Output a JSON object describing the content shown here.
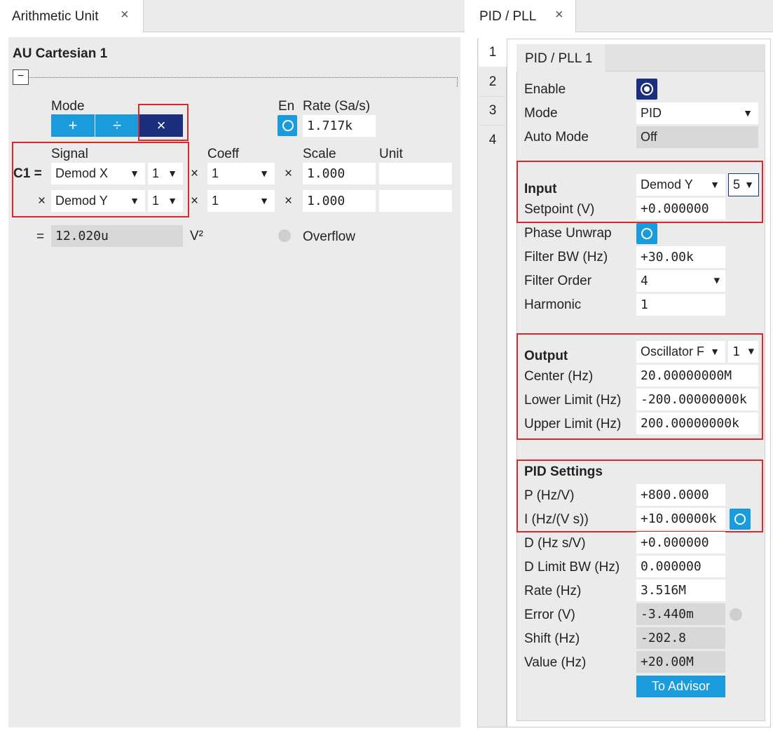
{
  "left": {
    "tab_title": "Arithmetic Unit",
    "tab_close": "×",
    "section_title": "AU Cartesian 1",
    "collapse_symbol": "−",
    "mode_label": "Mode",
    "mode_buttons": [
      "+",
      "÷",
      "×"
    ],
    "mode_selected": "×",
    "en_label": "En",
    "rate_label": "Rate (Sa/s)",
    "rate_value": "1.717k",
    "headers": {
      "signal": "Signal",
      "coeff": "Coeff",
      "scale": "Scale",
      "unit": "Unit"
    },
    "row_label": "C1 =",
    "rows": [
      {
        "prefix": "",
        "signal": "Demod X",
        "index": "1",
        "op1": "×",
        "coeff": "1",
        "op2": "×",
        "scale": "1.000",
        "unit": ""
      },
      {
        "prefix": "×",
        "signal": "Demod Y",
        "index": "1",
        "op1": "×",
        "coeff": "1",
        "op2": "×",
        "scale": "1.000",
        "unit": ""
      }
    ],
    "result_eq": "=",
    "result_value": "12.020u",
    "result_unit": "V²",
    "overflow_label": "Overflow"
  },
  "right": {
    "tab_title": "PID / PLL",
    "tab_close": "×",
    "side_tabs": [
      "1",
      "2",
      "3",
      "4"
    ],
    "inner_tab": "PID / PLL 1",
    "enable_label": "Enable",
    "mode_label": "Mode",
    "mode_value": "PID",
    "auto_mode_label": "Auto Mode",
    "auto_mode_value": "Off",
    "input_label": "Input",
    "input_signal": "Demod Y",
    "input_index": "5",
    "setpoint_label": "Setpoint (V)",
    "setpoint_value": "+0.000000",
    "phase_unwrap_label": "Phase Unwrap",
    "filter_bw_label": "Filter BW (Hz)",
    "filter_bw_value": "+30.00k",
    "filter_order_label": "Filter Order",
    "filter_order_value": "4",
    "harmonic_label": "Harmonic",
    "harmonic_value": "1",
    "output_label": "Output",
    "output_signal": "Oscillator F",
    "output_index": "1",
    "center_label": "Center (Hz)",
    "center_value": "20.00000000M",
    "lower_label": "Lower Limit (Hz)",
    "lower_value": "-200.00000000k",
    "upper_label": "Upper Limit (Hz)",
    "upper_value": "200.00000000k",
    "pid_settings_label": "PID Settings",
    "p_label": "P (Hz/V)",
    "p_value": "+800.0000",
    "i_label": "I (Hz/(V s))",
    "i_value": "+10.00000k",
    "d_label": "D (Hz s/V)",
    "d_value": "+0.000000",
    "dlimit_label": "D Limit BW (Hz)",
    "dlimit_value": "0.000000",
    "rate_label": "Rate (Hz)",
    "rate_value": "3.516M",
    "error_label": "Error (V)",
    "error_value": "-3.440m",
    "shift_label": "Shift (Hz)",
    "shift_value": "-202.8",
    "value_label": "Value (Hz)",
    "value_value": "+20.00M",
    "advisor_button": "To Advisor"
  },
  "colors": {
    "accent": "#1a9bdc",
    "selected": "#1b2f7e",
    "highlight": "#d42b2b",
    "panel": "#ebebeb"
  },
  "icons": {
    "close": "close-icon",
    "collapse": "minus-icon",
    "dropdown": "triangle-down-icon",
    "radio": "radio-icon"
  }
}
